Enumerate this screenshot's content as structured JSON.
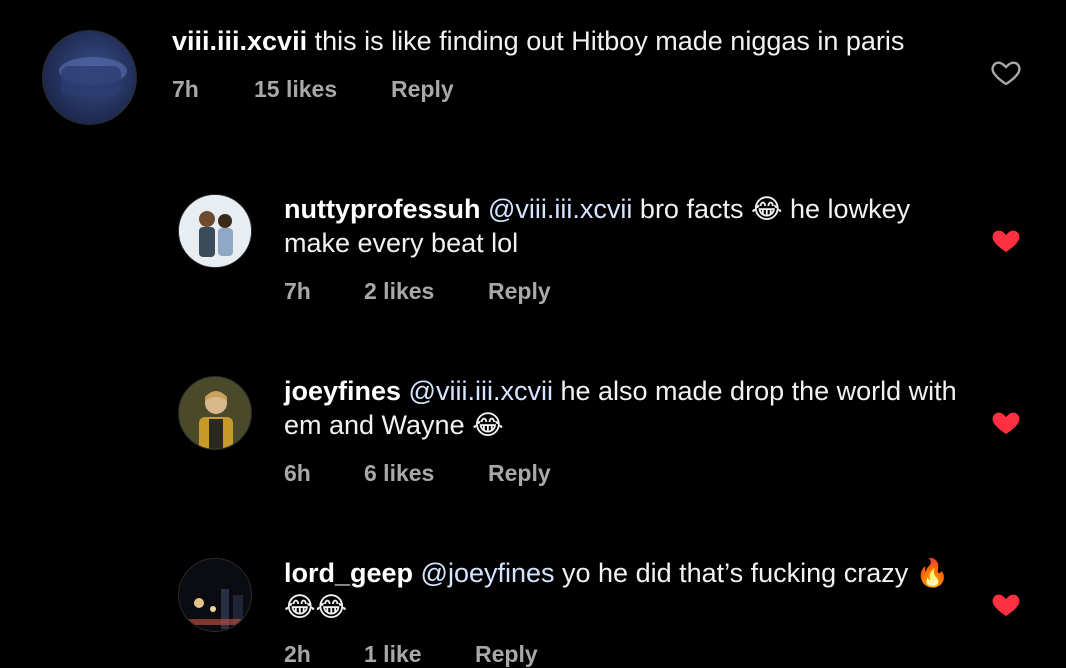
{
  "comments": [
    {
      "username": "viii.iii.xcvii",
      "mention": "",
      "text": " this is like finding out Hitboy made niggas in paris",
      "time": "7h",
      "likes": "15 likes",
      "reply": "Reply",
      "liked": false
    },
    {
      "username": "nuttyprofessuh",
      "mention": " @viii.iii.xcvii",
      "text": " bro facts 😂 he lowkey make every beat lol",
      "time": "7h",
      "likes": "2 likes",
      "reply": "Reply",
      "liked": true
    },
    {
      "username": "joeyfines",
      "mention": " @viii.iii.xcvii",
      "text": " he also made drop the world with em and Wayne 😂",
      "time": "6h",
      "likes": "6 likes",
      "reply": "Reply",
      "liked": true
    },
    {
      "username": "lord_geep",
      "mention": " @joeyfines",
      "text": " yo he did that’s fucking crazy 🔥😂😂",
      "time": "2h",
      "likes": "1 like",
      "reply": "Reply",
      "liked": true
    }
  ],
  "colors": {
    "background": "#000000",
    "heart_liked": "#ff3040",
    "heart_unliked": "#a8a8a8",
    "meta": "#a8a8a8"
  },
  "icons": [
    "heart-outline-icon",
    "heart-filled-icon"
  ]
}
